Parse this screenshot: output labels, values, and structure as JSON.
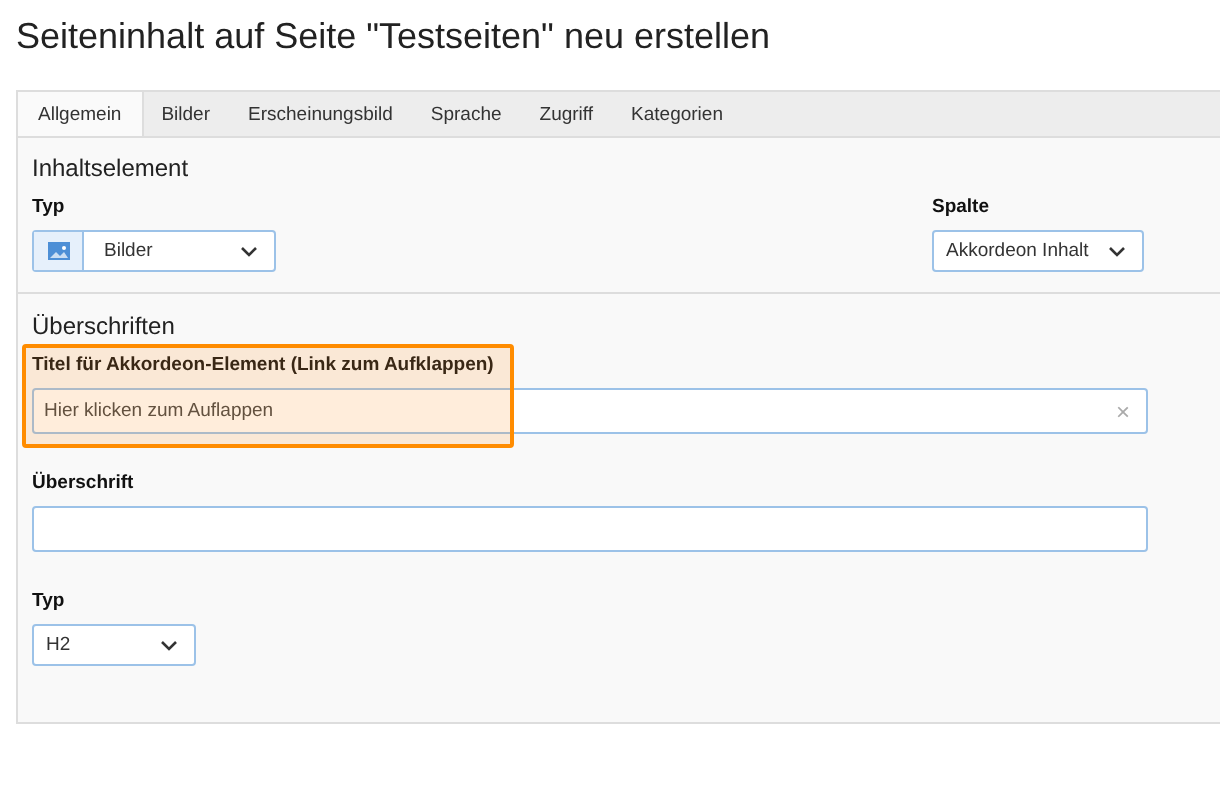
{
  "page_title": "Seiteninhalt auf Seite \"Testseiten\" neu erstellen",
  "tabs": [
    {
      "label": "Allgemein",
      "selected": true
    },
    {
      "label": "Bilder",
      "selected": false
    },
    {
      "label": "Erscheinungsbild",
      "selected": false
    },
    {
      "label": "Sprache",
      "selected": false
    },
    {
      "label": "Zugriff",
      "selected": false
    },
    {
      "label": "Kategorien",
      "selected": false
    }
  ],
  "sections": [
    {
      "title": "Inhaltselement",
      "rows": [
        [
          {
            "kind": "select",
            "label": "Typ",
            "value": "Bilder",
            "has_icon": true,
            "highlighted": false
          },
          {
            "kind": "select",
            "label": "Spalte",
            "value": "Akkordeon Inhalt",
            "has_icon": false,
            "highlighted": false
          }
        ]
      ]
    },
    {
      "title": "Überschriften",
      "rows": [
        [
          {
            "kind": "text",
            "label": "Titel für Akkordeon-Element (Link zum Aufklappen)",
            "value": "Hier klicken zum Auflappen",
            "clear": "×",
            "highlighted": true
          }
        ],
        [
          {
            "kind": "text",
            "label": "Überschrift",
            "highlighted": false
          }
        ],
        [
          {
            "kind": "select",
            "label": "Typ",
            "value": "H2",
            "has_icon": false,
            "highlighted": false
          }
        ]
      ]
    }
  ]
}
